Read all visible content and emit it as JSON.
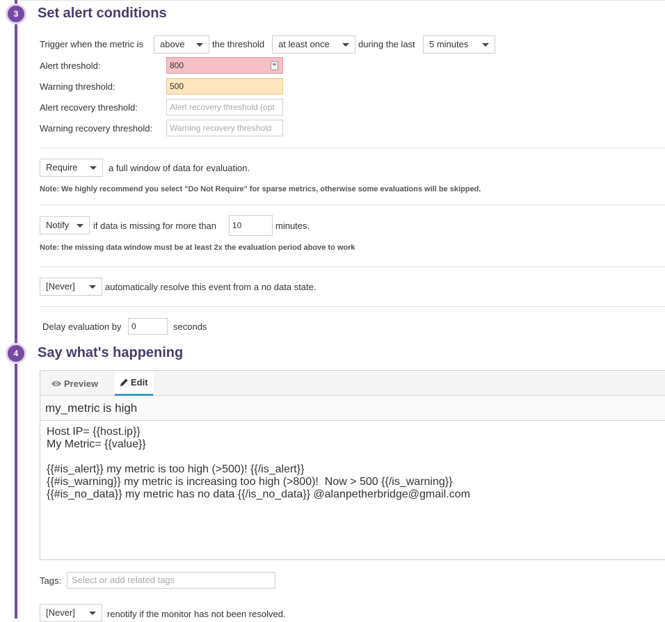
{
  "step3": {
    "number": "3",
    "title": "Set alert conditions",
    "trigger_prefix": "Trigger when the metric is",
    "comparison": "above",
    "threshold_word": "the threshold",
    "occurrence": "at least once",
    "during_word": "during the last",
    "window": "5 minutes",
    "alert_label": "Alert threshold:",
    "alert_value": "800",
    "warning_label": "Warning threshold:",
    "warning_value": "500",
    "alert_recovery_label": "Alert recovery threshold:",
    "alert_recovery_placeholder": "Alert recovery threshold (opt",
    "warning_recovery_label": "Warning recovery threshold:",
    "warning_recovery_placeholder": "Warning recovery threshold",
    "require_value": "Require",
    "require_text": "a full window of data for evaluation.",
    "require_note": "Note: We highly recommend you select \"Do Not Require\" for sparse metrics, otherwise some evaluations will be skipped.",
    "notify_value": "Notify",
    "notify_text": "if data is missing for more than",
    "missing_minutes": "10",
    "minutes_word": "minutes.",
    "missing_note": "Note: the missing data window must be at least 2x the evaluation period above to work",
    "resolve_value": "[Never]",
    "resolve_text": "automatically resolve this event from a no data state.",
    "delay_label": "Delay evaluation by",
    "delay_value": "0",
    "delay_unit": "seconds"
  },
  "step4": {
    "number": "4",
    "title": "Say what's happening",
    "tab_preview": "Preview",
    "tab_edit": "Edit",
    "subject": "my_metric is high",
    "message": "Host IP= {{host.ip}}\nMy Metric= {{value}}\n\n{{#is_alert}} my metric is too high (>500)! {{/is_alert}}\n{{#is_warning}} my metric is increasing too high (>800)!  Now > 500 {{/is_warning}}\n{{#is_no_data}} my metric has no data {{/is_no_data}} @alanpetherbridge@gmail.com",
    "tags_label": "Tags:",
    "tags_placeholder": "Select or add related tags",
    "renotify_value": "[Never]",
    "renotify_text": "renotify if the monitor has not been resolved."
  },
  "icons": {
    "calculator": "calculator-icon",
    "preview": "eye-icon",
    "edit": "pencil-icon"
  },
  "colors": {
    "accent": "#774aa4",
    "title": "#4a3c68",
    "alert_bg": "#f6bfc6",
    "warning_bg": "#ffe6bf",
    "tab_underline": "#3b9ad1"
  }
}
